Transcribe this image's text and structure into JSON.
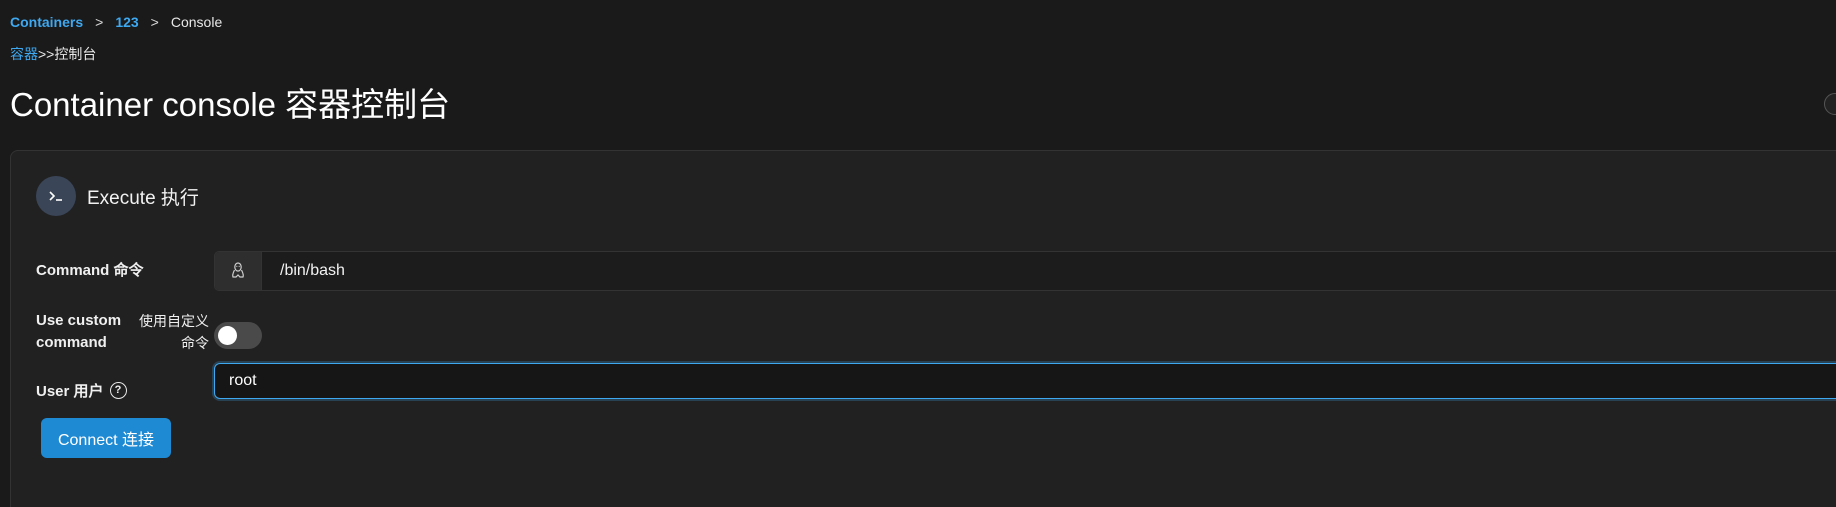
{
  "breadcrumb": {
    "items": [
      "Containers",
      "123"
    ],
    "current": "Console",
    "separator": ">"
  },
  "sub_breadcrumb": {
    "link": "容器",
    "separator": ">>",
    "current": "控制台"
  },
  "page": {
    "title": "Container console 容器控制台"
  },
  "card": {
    "title": "Execute 执行",
    "icon": "terminal-icon"
  },
  "form": {
    "command_label": "Command 命令",
    "command_value": "/bin/bash",
    "command_icon": "linux-icon",
    "custom_label_en": "Use custom command",
    "custom_label_zh": "使用自定义命令",
    "custom_enabled": false,
    "user_label": "User 用户",
    "user_value": "root",
    "connect_label": "Connect 连接"
  },
  "colors": {
    "background": "#1a1a1a",
    "card": "#212121",
    "accent": "#3ea8f0",
    "button": "#1f8ad4"
  }
}
